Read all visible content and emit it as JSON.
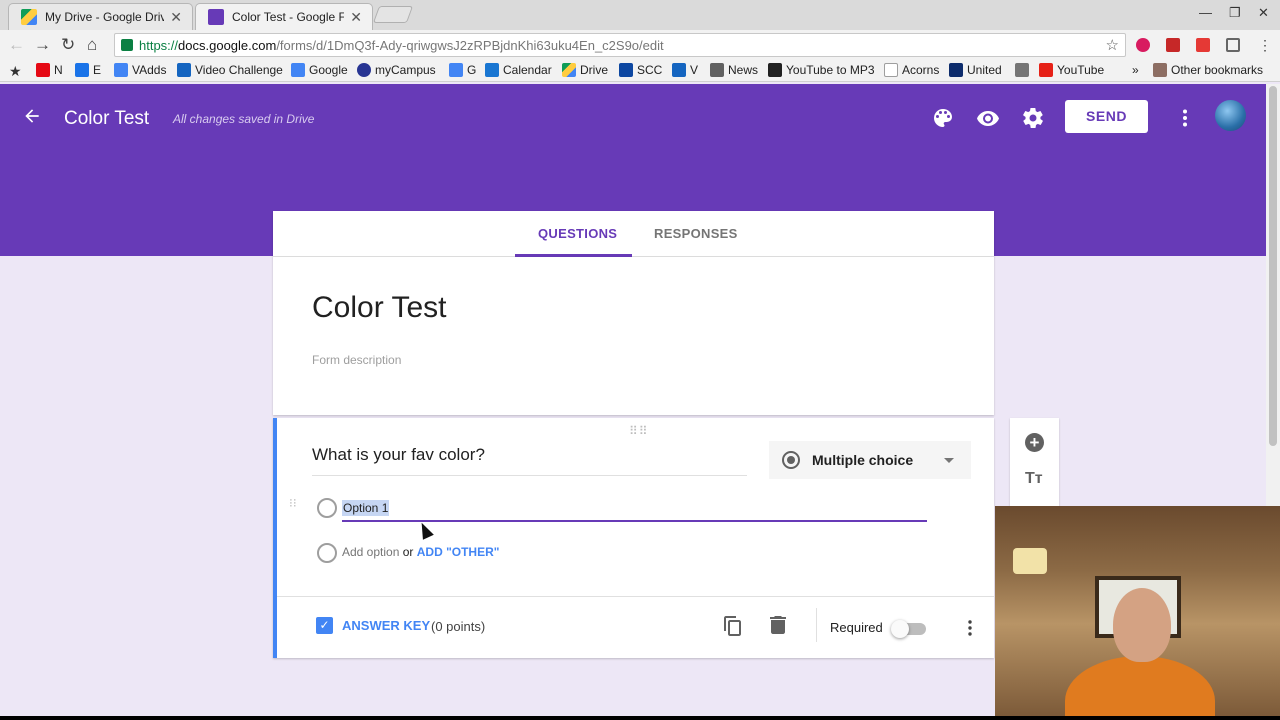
{
  "browser": {
    "tabs": [
      {
        "title": "My Drive - Google Drive",
        "favicon": "google-drive-icon",
        "active": false
      },
      {
        "title": "Color Test - Google Form",
        "favicon": "google-forms-icon",
        "active": true
      }
    ],
    "url": {
      "scheme": "https://",
      "host": "docs.google.com",
      "path": "/forms/d/1DmQ3f-Ady-qriwgwsJ2zRPBjdnKhi63uku4En_c2S9o/edit"
    },
    "bookmarks": [
      {
        "label": "N",
        "icon": "netflix-icon",
        "color": "#e50914"
      },
      {
        "label": "E",
        "icon": "e-icon",
        "color": "#1a73e8"
      },
      {
        "label": "VAdds",
        "icon": "google-icon",
        "color": "#4285f4"
      },
      {
        "label": "Video Challenge",
        "icon": "page-icon",
        "color": "#1565c0"
      },
      {
        "label": "Google",
        "icon": "google-icon",
        "color": "#4285f4"
      },
      {
        "label": "myCampus",
        "icon": "campus-icon",
        "color": "#283593"
      },
      {
        "label": "G",
        "icon": "google-icon",
        "color": "#4285f4"
      },
      {
        "label": "Calendar",
        "icon": "calendar-icon",
        "color": "#1976d2"
      },
      {
        "label": "Drive",
        "icon": "drive-icon",
        "color": "#0f9d58"
      },
      {
        "label": "SCC",
        "icon": "scc-icon",
        "color": "#0d47a1"
      },
      {
        "label": "V",
        "icon": "v-icon",
        "color": "#1565c0"
      },
      {
        "label": "News",
        "icon": "news-icon",
        "color": "#616161"
      },
      {
        "label": "YouTube to MP3",
        "icon": "music-icon",
        "color": "#212121"
      },
      {
        "label": "Acorns",
        "icon": "page-icon",
        "color": "#9e9e9e"
      },
      {
        "label": "United",
        "icon": "united-icon",
        "color": "#0d2c6c"
      },
      {
        "label": "",
        "icon": "extension-icon",
        "color": "#757575"
      },
      {
        "label": "YouTube",
        "icon": "youtube-icon",
        "color": "#e62117"
      }
    ],
    "other_bookmarks": "Other bookmarks",
    "overflow": "»"
  },
  "app": {
    "title": "Color Test",
    "saved_status": "All changes saved in Drive",
    "send_label": "SEND",
    "accent_color": "#673ab7",
    "tabs": [
      {
        "label": "QUESTIONS",
        "active": true
      },
      {
        "label": "RESPONSES",
        "active": false
      }
    ]
  },
  "form": {
    "title": "Color Test",
    "description_placeholder": "Form description"
  },
  "question": {
    "text": "What is your fav color?",
    "type": "Multiple choice",
    "options": [
      "Option 1"
    ],
    "add_option": "Add option",
    "or_text": "or",
    "add_other": "ADD \"OTHER\"",
    "answer_key": "ANSWER KEY",
    "points": "(0 points)",
    "required_label": "Required",
    "required": false
  }
}
